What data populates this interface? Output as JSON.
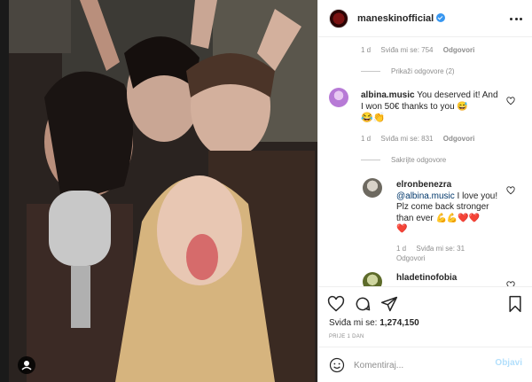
{
  "post": {
    "username": "maneskinofficial",
    "verified": true,
    "likes_label": "Sviđa mi se:",
    "likes_count": "1,274,150",
    "posted_time": "PRIJE 1 DAN"
  },
  "comments": [
    {
      "meta": {
        "time": "1 d",
        "likes": "Sviđa mi se: 754",
        "reply": "Odgovori"
      },
      "show_replies": "Prikaži odgovore (2)"
    },
    {
      "username": "albina.music",
      "text": "You deserved it! And I won 50€ thanks to you 😅",
      "emojis": "😂👏",
      "meta": {
        "time": "1 d",
        "likes": "Sviđa mi se: 831",
        "reply": "Odgovori"
      },
      "hide_replies": "Sakrijte odgovore",
      "replies": [
        {
          "username": "elronbenezra",
          "mention": "@albina.music",
          "text": "I love you! Plz come back stronger than ever 💪💪❤️❤️",
          "emoji_line2": "❤️",
          "meta": {
            "time": "1 d",
            "likes": "Sviđa mi se: 31",
            "reply": "Odgovori"
          }
        },
        {
          "username": "hladetinofobia"
        }
      ]
    }
  ],
  "comment_bar": {
    "placeholder": "Komentiraj...",
    "post_label": "Objavi"
  },
  "colors": {
    "link": "#00376b",
    "verified": "#3897f0",
    "muted": "#8e8e8e",
    "post_button_disabled": "#b2dffc"
  },
  "icons": [
    "more-options-icon",
    "heart-icon",
    "comment-icon",
    "share-icon",
    "bookmark-icon",
    "smile-icon",
    "user-tag-icon",
    "verified-badge-icon"
  ]
}
